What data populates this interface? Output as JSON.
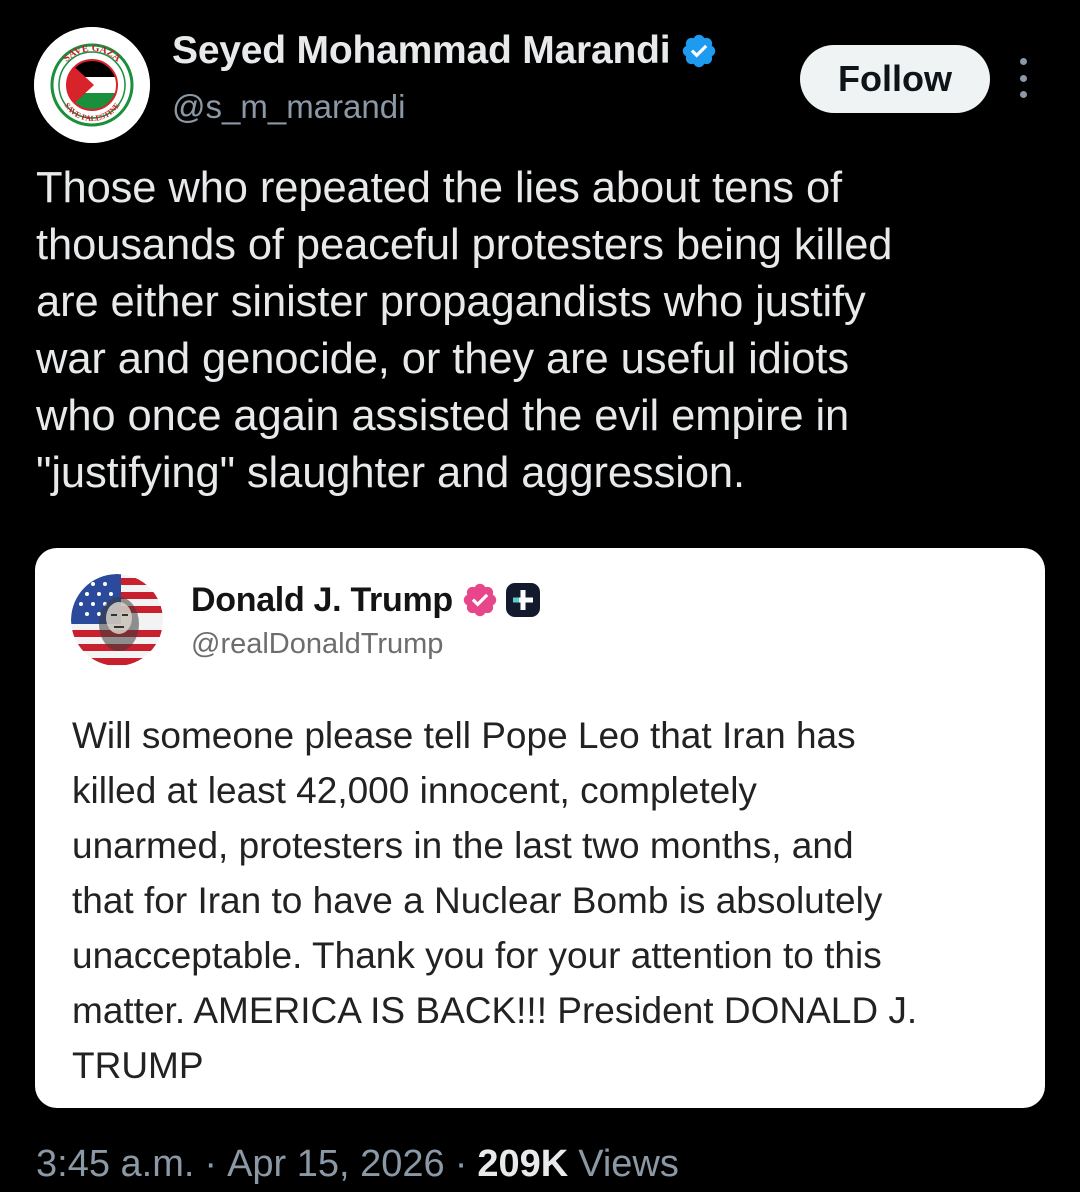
{
  "author": {
    "display_name": "Seyed Mohammad Marandi",
    "handle": "@s_m_marandi",
    "verified": true,
    "avatar_text": "SAVE GAZA · SAVE PALESTINE"
  },
  "actions": {
    "follow_label": "Follow"
  },
  "tweet": {
    "text": "Those who repeated the lies about tens of\nthousands of peaceful protesters being killed\nare either sinister propagandists who justify\nwar and genocide, or they are useful idiots\nwho once again assisted the evil empire in\n\"justifying\" slaughter and aggression."
  },
  "quoted_post": {
    "display_name": "Donald J. Trump",
    "handle": "@realDonaldTrump",
    "text": "Will someone please tell Pope Leo that Iran has\nkilled at least 42,000 innocent, completely\nunarmed, protesters in the last two months, and\nthat for Iran to have a Nuclear Bomb is absolutely\nunacceptable. Thank you for your attention to this\nmatter. AMERICA IS BACK!!! President DONALD J.\nTRUMP"
  },
  "footer": {
    "time": "3:45 a.m.",
    "separator": "·",
    "date": "Apr 15, 2026",
    "views_count": "209K",
    "views_label": "Views"
  },
  "colors": {
    "background": "#000000",
    "verified_blue": "#1d9bf0",
    "truth_badge_pink": "#e8468a",
    "follow_bg": "#eff3f4"
  }
}
